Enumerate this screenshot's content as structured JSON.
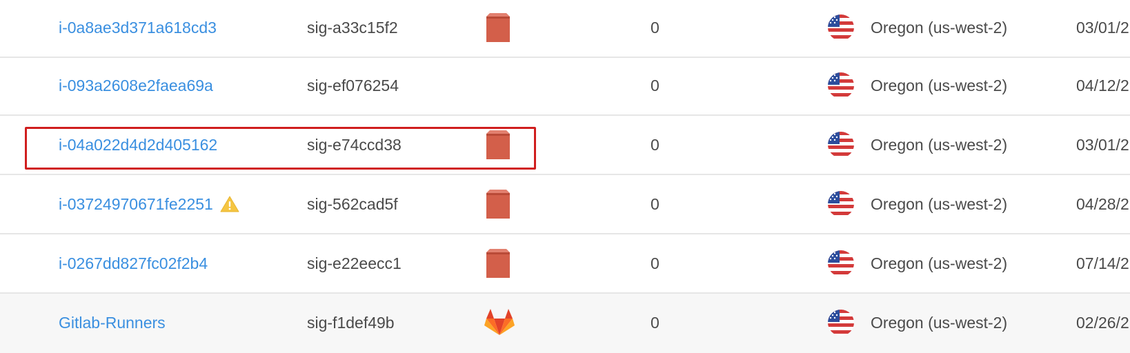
{
  "rows": [
    {
      "name": "i-0a8ae3d371a618cd3",
      "sig": "sig-a33c15f2",
      "icon": "aws-box-icon",
      "count": "0",
      "flag": "us-flag-icon",
      "region": "Oregon (us-west-2)",
      "date": "03/01/2"
    },
    {
      "name": "i-093a2608e2faea69a",
      "sig": "sig-ef076254",
      "icon": "",
      "count": "0",
      "flag": "us-flag-icon",
      "region": "Oregon (us-west-2)",
      "date": "04/12/2"
    },
    {
      "name": "i-04a022d4d2d405162",
      "sig": "sig-e74ccd38",
      "icon": "aws-box-icon",
      "count": "0",
      "flag": "us-flag-icon",
      "region": "Oregon (us-west-2)",
      "date": "03/01/2"
    },
    {
      "name": "i-03724970671fe2251",
      "sig": "sig-562cad5f",
      "icon": "aws-box-icon",
      "count": "0",
      "flag": "us-flag-icon",
      "region": "Oregon (us-west-2)",
      "date": "04/28/2",
      "warning": "warning-icon"
    },
    {
      "name": "i-0267dd827fc02f2b4",
      "sig": "sig-e22eecc1",
      "icon": "aws-box-icon",
      "count": "0",
      "flag": "us-flag-icon",
      "region": "Oregon (us-west-2)",
      "date": "07/14/2"
    },
    {
      "name": "Gitlab-Runners",
      "sig": "sig-f1def49b",
      "icon": "gitlab-icon",
      "count": "0",
      "flag": "us-flag-icon",
      "region": "Oregon (us-west-2)",
      "date": "02/26/2"
    }
  ],
  "colors": {
    "link": "#3a8fe0",
    "highlight": "#d01e1e",
    "aws_box": "#d35f4a",
    "warning": "#f5c542"
  }
}
